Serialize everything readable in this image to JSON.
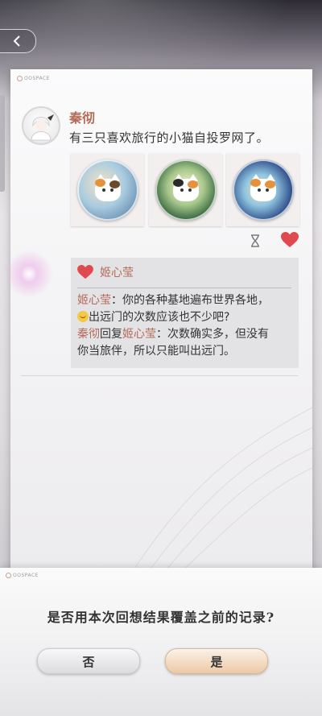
{
  "header": {
    "back_icon": "chevron-left-icon"
  },
  "brand": {
    "logo_text": "OOSPACE"
  },
  "post": {
    "author": "秦彻",
    "text": "有三只喜欢旅行的小猫自投罗网了。",
    "photos": [
      "badge-travel-globe-cat",
      "badge-sunflower-cat",
      "badge-night-sky-cat"
    ],
    "actions": {
      "timer_icon": "hourglass-icon",
      "like_icon": "heart-icon",
      "like_color": "#e04a4f"
    }
  },
  "comments": {
    "likes": {
      "names": "姬心莹"
    },
    "items": [
      {
        "author": "姬心莹",
        "line1": "：你的各种基地遍布世界各地，",
        "line2": "出远门的次数应该也不少吧?"
      },
      {
        "author": "秦彻",
        "reply_word": "回复",
        "reply_to": "姬心莹",
        "line1": "：次数确实多，但没有",
        "line2": "你当旅伴，所以只能叫出远门。"
      }
    ]
  },
  "dialog": {
    "question": "是否用本次回想结果覆盖之前的记录?",
    "no_label": "否",
    "yes_label": "是"
  },
  "colors": {
    "accent_name": "#b36b57",
    "heart": "#e04a4f"
  }
}
